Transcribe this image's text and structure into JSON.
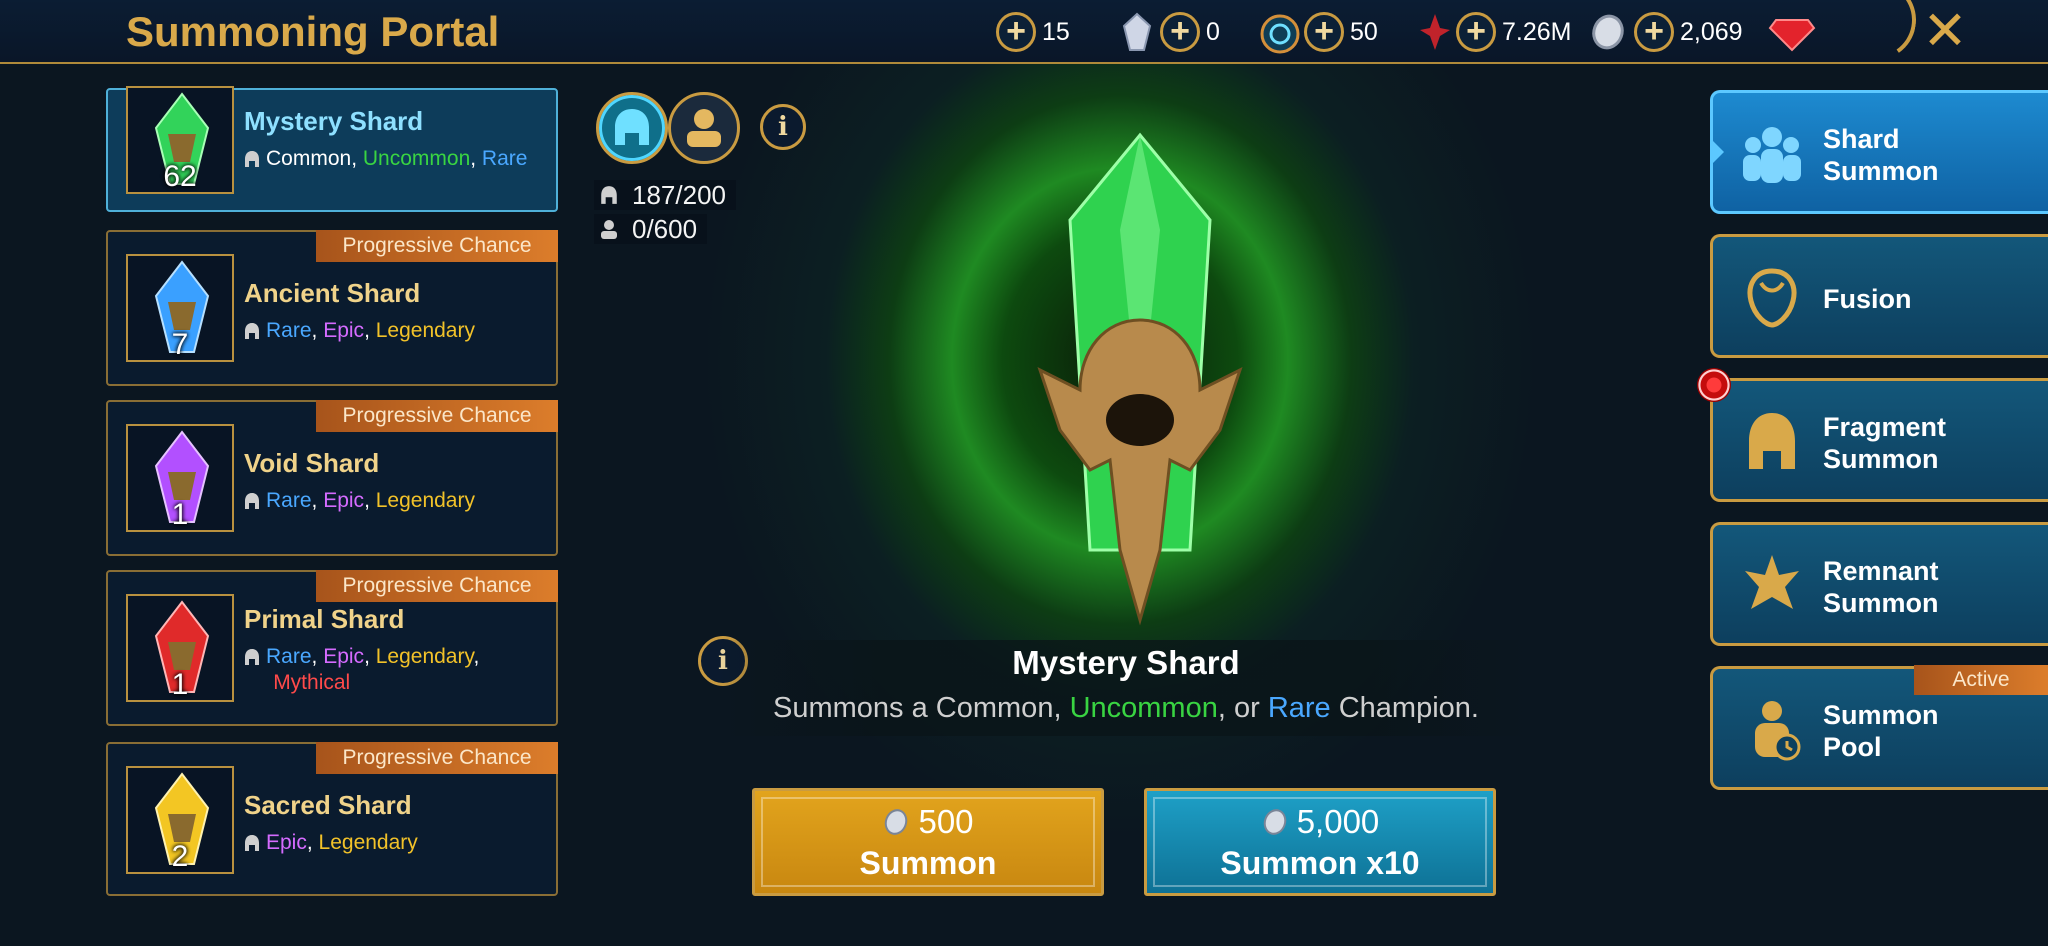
{
  "header": {
    "title": "Summoning Portal"
  },
  "currencies": [
    {
      "name": "mystery-shard-currency",
      "value": "15",
      "icon": "crystal-icon"
    },
    {
      "name": "energy-currency",
      "value": "0",
      "icon": "portal-icon"
    },
    {
      "name": "arena-tokens",
      "value": "50",
      "icon": "blood-shard-icon"
    },
    {
      "name": "silver",
      "value": "7.26M",
      "icon": "silver-coin-icon"
    },
    {
      "name": "gems",
      "value": "2,069",
      "icon": "ruby-icon"
    }
  ],
  "shards": [
    {
      "name": "Mystery Shard",
      "count": "62",
      "badge": "",
      "rarities": [
        "Common",
        "Uncommon",
        "Rare"
      ],
      "color": "#34d65a",
      "selected": true
    },
    {
      "name": "Ancient Shard",
      "count": "7",
      "badge": "Progressive Chance",
      "rarities": [
        "Rare",
        "Epic",
        "Legendary"
      ],
      "color": "#3aa0ff",
      "selected": false
    },
    {
      "name": "Void Shard",
      "count": "1",
      "badge": "Progressive Chance",
      "rarities": [
        "Rare",
        "Epic",
        "Legendary"
      ],
      "color": "#b250ff",
      "selected": false
    },
    {
      "name": "Primal Shard",
      "count": "1",
      "badge": "Progressive Chance",
      "rarities": [
        "Rare",
        "Epic",
        "Legendary",
        "Mythical"
      ],
      "color": "#e02a2a",
      "selected": false
    },
    {
      "name": "Sacred Shard",
      "count": "2",
      "badge": "Progressive Chance",
      "rarities": [
        "Epic",
        "Legendary"
      ],
      "color": "#f3c623",
      "selected": false
    }
  ],
  "counters": {
    "champions": "187/200",
    "heroes": "0/600"
  },
  "center": {
    "title": "Mystery Shard",
    "desc_prefix": "Summons a Common, ",
    "desc_uncommon": "Uncommon",
    "desc_mid": ", or ",
    "desc_rare": "Rare",
    "desc_suffix": " Champion."
  },
  "buttons": {
    "summon": {
      "cost": "500",
      "label": "Summon"
    },
    "summon10": {
      "cost": "5,000",
      "label": "Summon x10"
    }
  },
  "menu": [
    {
      "label_1": "Shard",
      "label_2": "Summon",
      "icon": "champions-icon",
      "active": true
    },
    {
      "label_1": "Fusion",
      "label_2": "",
      "icon": "fusion-icon",
      "active": false
    },
    {
      "label_1": "Fragment",
      "label_2": "Summon",
      "icon": "fragment-helm-icon",
      "active": false
    },
    {
      "label_1": "Remnant",
      "label_2": "Summon",
      "icon": "remnant-icon",
      "active": false
    },
    {
      "label_1": "Summon",
      "label_2": "Pool",
      "icon": "summon-pool-icon",
      "active": false,
      "badge": "Active"
    }
  ],
  "colors": {
    "gold": "#c99b41",
    "title_gold": "#d9a94a",
    "uncommon": "#39d442",
    "rare": "#4aa8ff",
    "epic": "#d56bff",
    "legendary": "#f2c229",
    "mythical": "#ff4a4a"
  }
}
